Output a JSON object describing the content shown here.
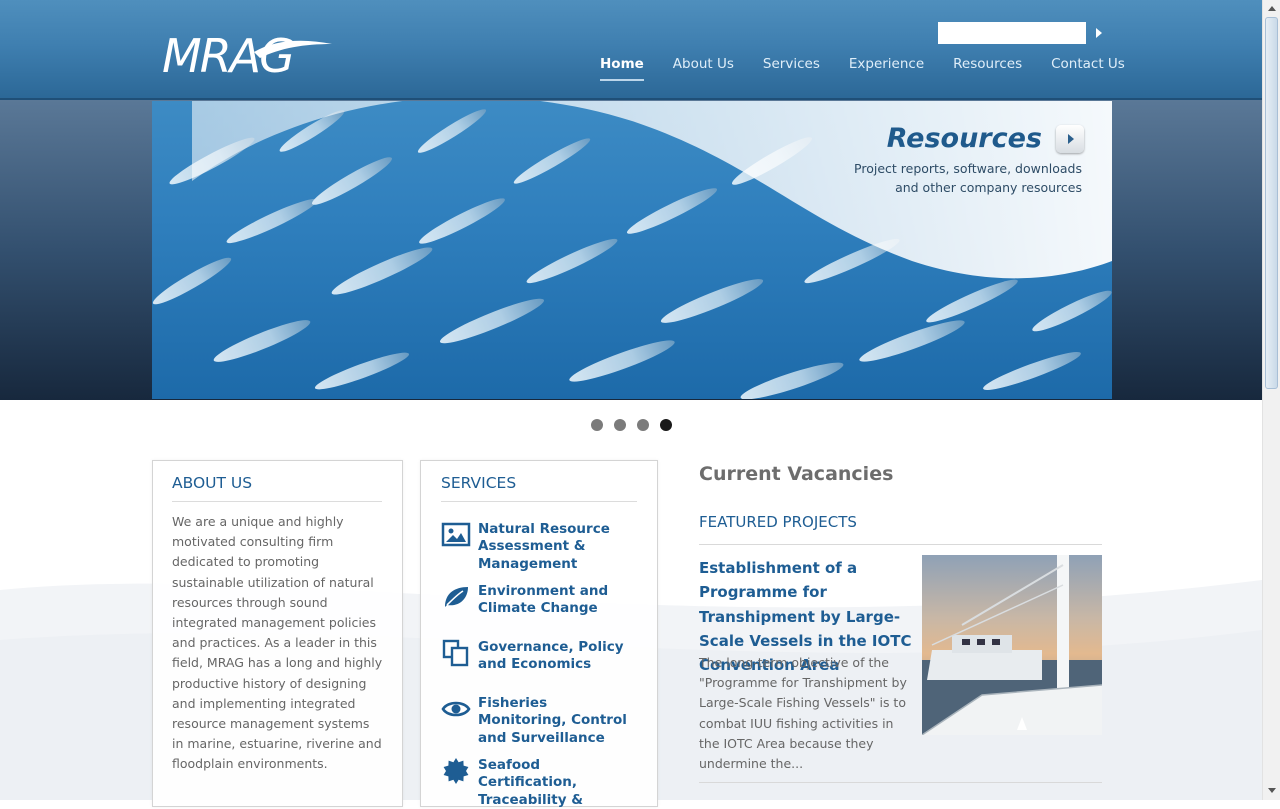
{
  "header": {
    "logo_text": "MRAG",
    "search": {
      "value": "",
      "placeholder": ""
    },
    "nav": [
      {
        "label": "Home",
        "active": true
      },
      {
        "label": "About Us"
      },
      {
        "label": "Services"
      },
      {
        "label": "Experience"
      },
      {
        "label": "Resources"
      },
      {
        "label": "Contact Us"
      }
    ]
  },
  "banner": {
    "title": "Resources",
    "subtitle_line1": "Project reports, software, downloads",
    "subtitle_line2": "and other company resources",
    "slide_count": 4,
    "active_slide": 4
  },
  "about": {
    "title": "ABOUT US",
    "text": "We are a unique and highly motivated consulting firm dedicated to promoting sustainable utilization of natural resources through sound integrated management policies and practices. As a leader in this field, MRAG has a long and highly productive history of designing and implementing integrated resource management systems in marine, estuarine, riverine and floodplain environments."
  },
  "services": {
    "title": "SERVICES",
    "items": [
      {
        "label": "Natural Resource Assessment & Management",
        "icon": "image-icon"
      },
      {
        "label": "Environment and Climate Change",
        "icon": "leaf-icon"
      },
      {
        "label": "Governance, Policy and Economics",
        "icon": "documents-icon"
      },
      {
        "label": "Fisheries Monitoring, Control and Surveillance",
        "icon": "eye-icon"
      },
      {
        "label": "Seafood Certification, Traceability &",
        "icon": "badge-icon"
      }
    ]
  },
  "right": {
    "vacancies": "Current Vacancies",
    "featured_title": "FEATURED PROJECTS",
    "project": {
      "title": "Establishment of a Programme for Transhipment by Large-Scale Vessels in the IOTC Convention Area",
      "excerpt": "The long-term objective of the \"Programme  for Transhipment by Large-Scale Fishing Vessels\" is to combat IUU fishing activities in the IOTC Area because they undermine the..."
    }
  },
  "colors": {
    "header": "#3f7fb0",
    "accent_blue": "#1e5d93",
    "body_text": "#666666",
    "heading_grey": "#6d6d6d"
  }
}
